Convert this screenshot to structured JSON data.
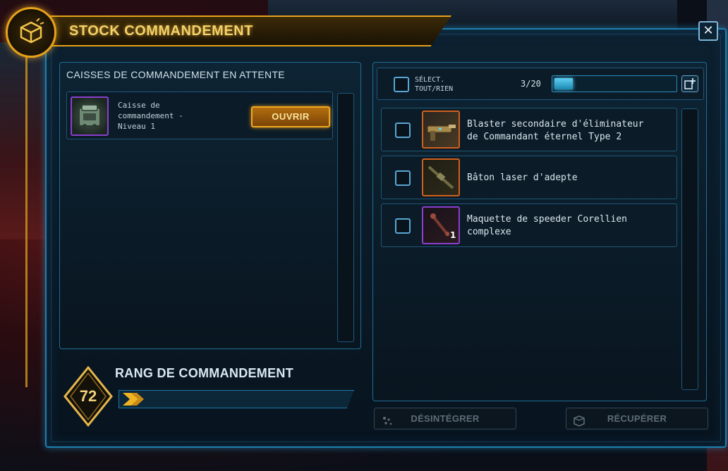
{
  "window": {
    "title": "STOCK COMMANDEMENT",
    "close_label": "✕"
  },
  "left_panel": {
    "heading": "CAISSES DE COMMANDEMENT EN ATTENTE",
    "crates": [
      {
        "name": "Caisse de commandement - Niveau 1",
        "name_lines": [
          "Caisse de",
          "commandement -",
          "Niveau 1"
        ],
        "action_label": "OUVRIR"
      }
    ]
  },
  "rank": {
    "title": "RANG DE COMMANDEMENT",
    "level": "72",
    "progress_fraction": 0.0
  },
  "right_panel": {
    "select_all_label": "SÉLECT. TOUT/RIEN",
    "select_all_lines": [
      "SÉLECT.",
      "TOUT/RIEN"
    ],
    "count_text": "3/20",
    "count_value": 3,
    "count_max": 20,
    "items": [
      {
        "name": "Blaster secondaire d'éliminateur de Commandant éternel Type 2",
        "name_lines": [
          "Blaster secondaire d'éliminateur",
          "de Commandant éternel Type 2"
        ],
        "rarity_color": "#d0601e",
        "quantity": ""
      },
      {
        "name": "Bâton laser d'adepte",
        "name_lines": [
          "Bâton laser d'adepte"
        ],
        "rarity_color": "#d0601e",
        "quantity": ""
      },
      {
        "name": "Maquette de speeder Corellien complexe",
        "name_lines": [
          "Maquette de speeder Corellien",
          "complexe"
        ],
        "rarity_color": "#8a3fcf",
        "quantity": "1"
      }
    ]
  },
  "bottom": {
    "disintegrate_label": "DÉSINTÉGRER",
    "retrieve_label": "RÉCUPÉRER"
  },
  "colors": {
    "gold_accent": "#e6a21a",
    "blue_frame": "#1f7fae",
    "epic_purple": "#8a3fcf",
    "legendary_orange": "#d0601e"
  }
}
